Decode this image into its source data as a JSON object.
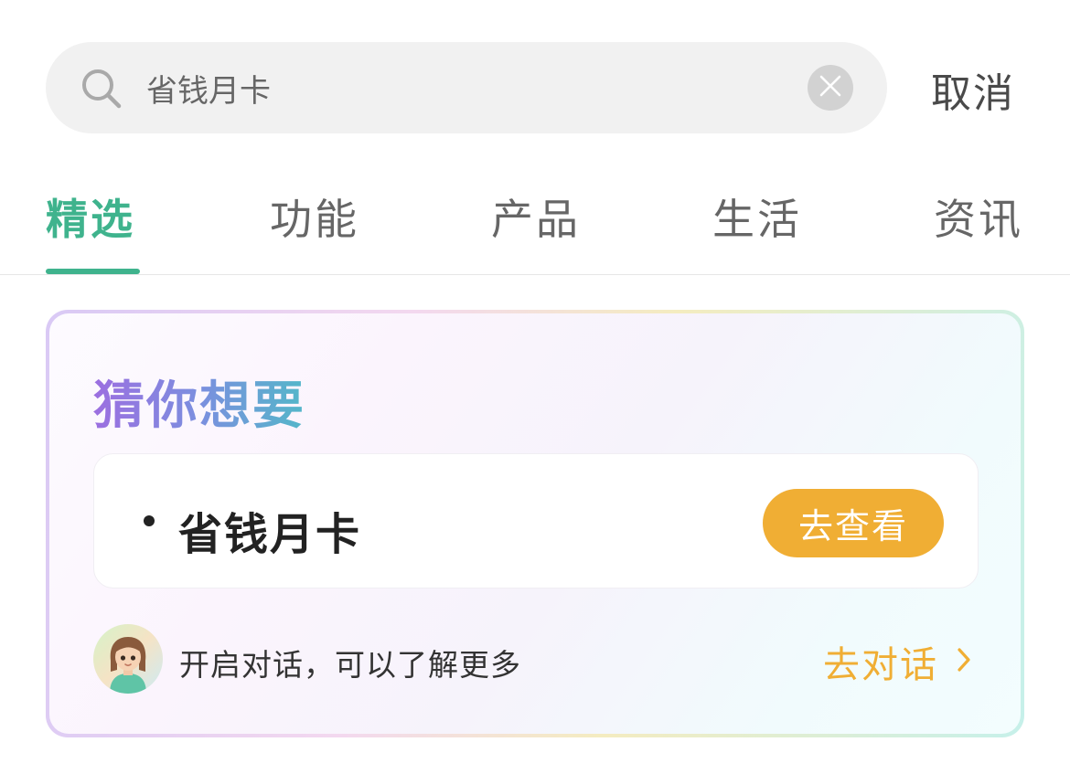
{
  "search": {
    "value": "省钱月卡",
    "cancel_label": "取消"
  },
  "tabs": [
    {
      "label": "精选",
      "active": true
    },
    {
      "label": "功能",
      "active": false
    },
    {
      "label": "产品",
      "active": false
    },
    {
      "label": "生活",
      "active": false
    },
    {
      "label": "资讯",
      "active": false
    }
  ],
  "guess_card": {
    "title": "猜你想要",
    "suggestion": {
      "text": "省钱月卡",
      "button_label": "去查看"
    },
    "chat": {
      "hint": "开启对话，可以了解更多",
      "link_label": "去对话"
    }
  },
  "colors": {
    "accent": "#3fb38d",
    "button": "#f0ae34",
    "title_gradient_start": "#9c6fe0",
    "title_gradient_end": "#53b7c9"
  },
  "icons": {
    "search": "search-icon",
    "clear": "clear-icon",
    "avatar": "assistant-avatar",
    "chevron": "chevron-right-icon"
  }
}
